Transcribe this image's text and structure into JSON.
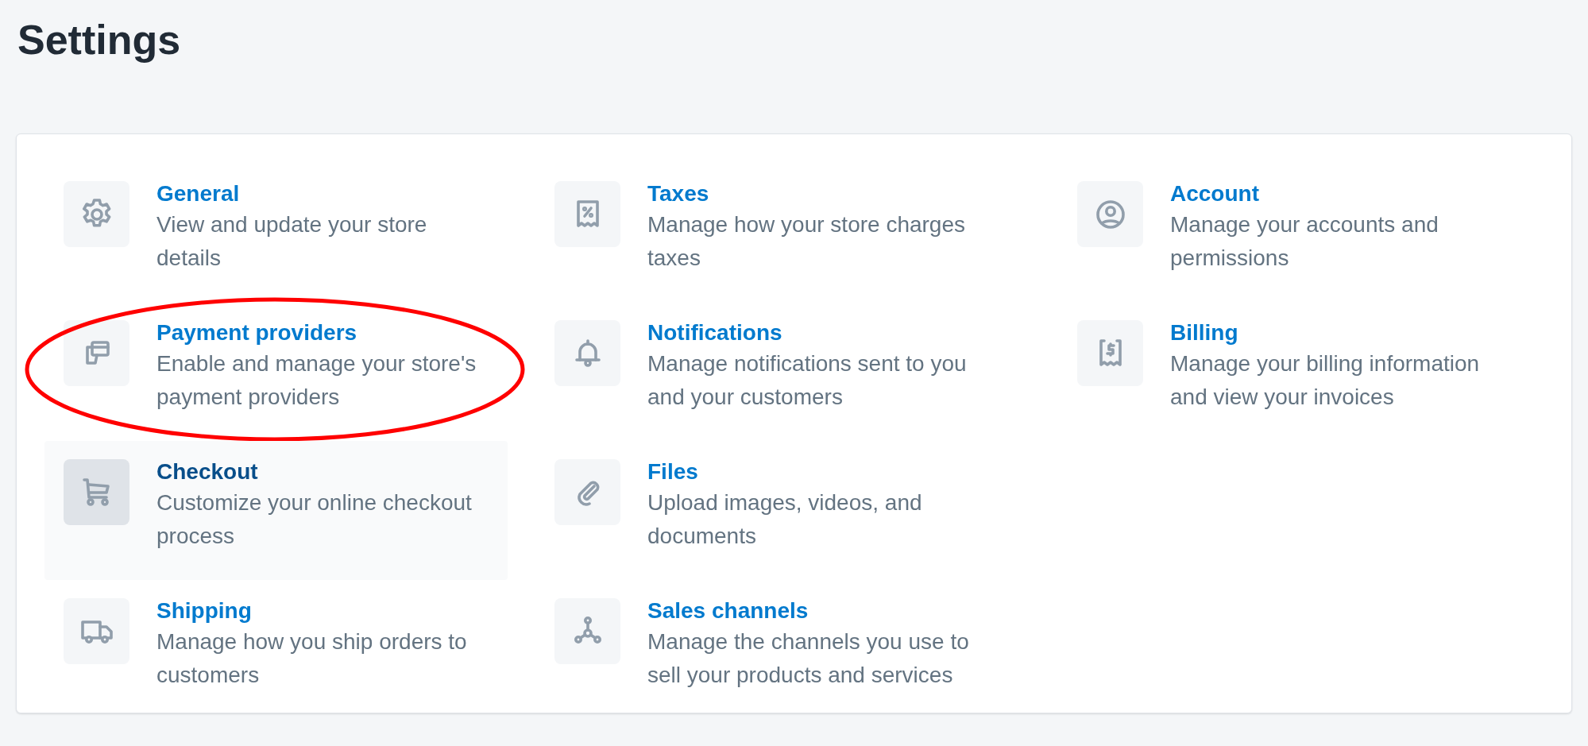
{
  "page_title": "Settings",
  "columns": [
    [
      {
        "kind": "gear",
        "title": "General",
        "description": "View and update your store details",
        "hovered": false,
        "circled": false
      },
      {
        "kind": "cards",
        "title": "Payment providers",
        "description": "Enable and manage your store's payment providers",
        "hovered": false,
        "circled": true
      },
      {
        "kind": "cart",
        "title": "Checkout",
        "description": "Customize your online checkout process",
        "hovered": true,
        "circled": false
      },
      {
        "kind": "truck",
        "title": "Shipping",
        "description": "Manage how you ship orders to customers",
        "hovered": false,
        "circled": false
      }
    ],
    [
      {
        "kind": "receipt-percent",
        "title": "Taxes",
        "description": "Manage how your store charges taxes",
        "hovered": false,
        "circled": false
      },
      {
        "kind": "bell",
        "title": "Notifications",
        "description": "Manage notifications sent to you and your customers",
        "hovered": false,
        "circled": false
      },
      {
        "kind": "paperclip",
        "title": "Files",
        "description": "Upload images, videos, and documents",
        "hovered": false,
        "circled": false
      },
      {
        "kind": "nodes",
        "title": "Sales channels",
        "description": "Manage the channels you use to sell your products and services",
        "hovered": false,
        "circled": false
      }
    ],
    [
      {
        "kind": "user",
        "title": "Account",
        "description": "Manage your accounts and permissions",
        "hovered": false,
        "circled": false
      },
      {
        "kind": "receipt-dollar",
        "title": "Billing",
        "description": "Manage your billing information and view your invoices",
        "hovered": false,
        "circled": false
      }
    ]
  ]
}
